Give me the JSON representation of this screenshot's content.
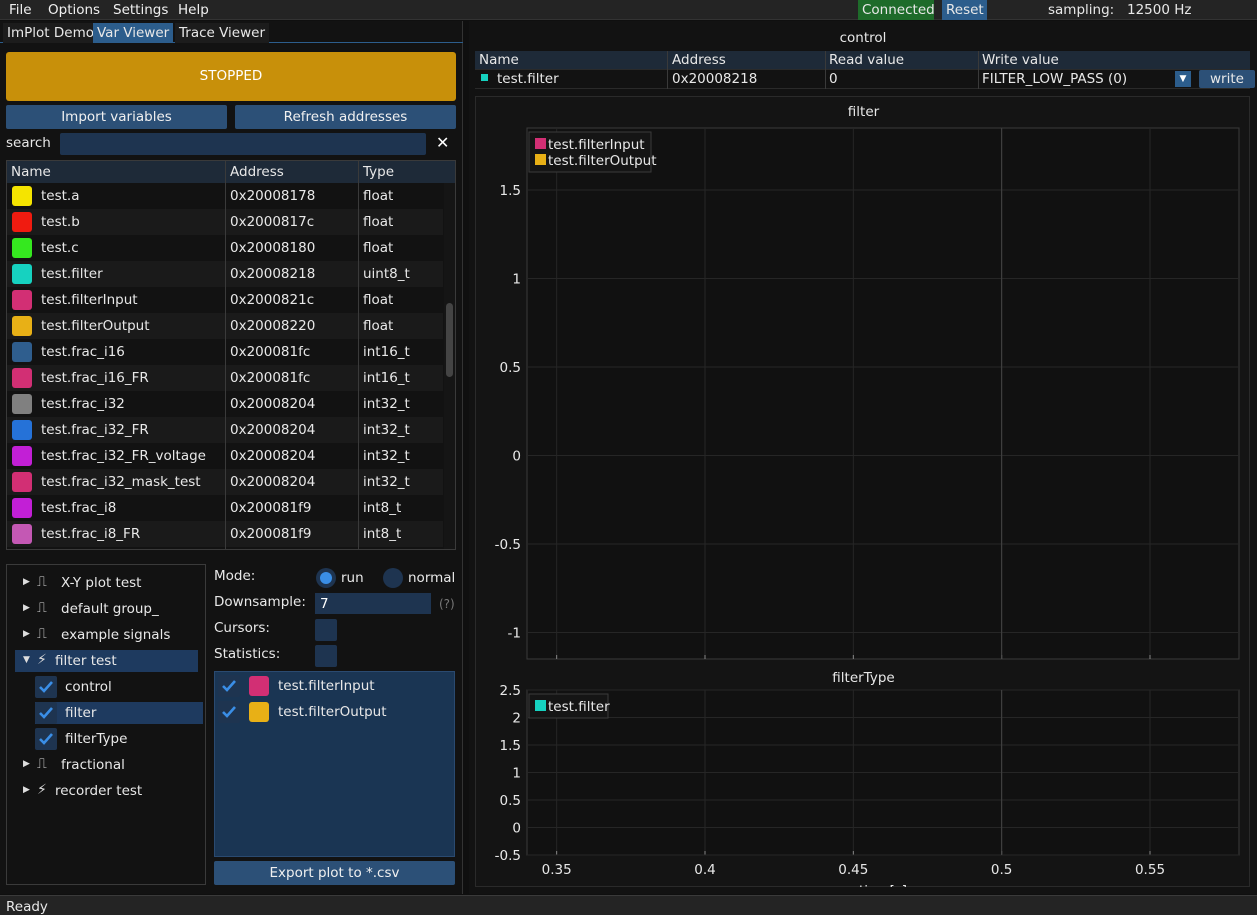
{
  "menu": {
    "file": "File",
    "options": "Options",
    "settings": "Settings",
    "help": "Help"
  },
  "connection": {
    "status": "Connected",
    "reset": "Reset",
    "sampling_label": "sampling:",
    "sampling_value": "12500 Hz"
  },
  "tabs": [
    "ImPlot Demo",
    "Var Viewer",
    "Trace Viewer"
  ],
  "run_state": "STOPPED",
  "buttons": {
    "import": "Import variables",
    "refresh": "Refresh addresses",
    "export": "Export plot to *.csv",
    "write": "write"
  },
  "search": {
    "label": "search",
    "value": "",
    "clear": "✕"
  },
  "var_table": {
    "headers": [
      "Name",
      "Address",
      "Type"
    ],
    "rows": [
      {
        "color": "#f5e400",
        "name": "test.a",
        "address": "0x20008178",
        "type": "float"
      },
      {
        "color": "#f01b10",
        "name": "test.b",
        "address": "0x2000817c",
        "type": "float"
      },
      {
        "color": "#35e81f",
        "name": "test.c",
        "address": "0x20008180",
        "type": "float"
      },
      {
        "color": "#16d2c0",
        "name": "test.filter",
        "address": "0x20008218",
        "type": "uint8_t"
      },
      {
        "color": "#d22f74",
        "name": "test.filterInput",
        "address": "0x2000821c",
        "type": "float"
      },
      {
        "color": "#e8b016",
        "name": "test.filterOutput",
        "address": "0x20008220",
        "type": "float"
      },
      {
        "color": "#2f5e8e",
        "name": "test.frac_i16",
        "address": "0x200081fc",
        "type": "int16_t"
      },
      {
        "color": "#d22f74",
        "name": "test.frac_i16_FR",
        "address": "0x200081fc",
        "type": "int16_t"
      },
      {
        "color": "#808080",
        "name": "test.frac_i32",
        "address": "0x20008204",
        "type": "int32_t"
      },
      {
        "color": "#2572d8",
        "name": "test.frac_i32_FR",
        "address": "0x20008204",
        "type": "int32_t"
      },
      {
        "color": "#c21fd6",
        "name": "test.frac_i32_FR_voltage",
        "address": "0x20008204",
        "type": "int32_t"
      },
      {
        "color": "#d22f74",
        "name": "test.frac_i32_mask_test",
        "address": "0x20008204",
        "type": "int32_t"
      },
      {
        "color": "#c21fd6",
        "name": "test.frac_i8",
        "address": "0x200081f9",
        "type": "int8_t"
      },
      {
        "color": "#c458b4",
        "name": "test.frac_i8_FR",
        "address": "0x200081f9",
        "type": "int8_t"
      }
    ]
  },
  "tree": [
    {
      "label": "X-Y plot test",
      "icon": "signal-icon"
    },
    {
      "label": "default group_",
      "icon": "signal-icon"
    },
    {
      "label": "example signals",
      "icon": "signal-icon"
    },
    {
      "label": "filter test",
      "icon": "bolt-icon",
      "children": [
        "control",
        "filter",
        "filterType"
      ]
    },
    {
      "label": "fractional",
      "icon": "signal-icon"
    },
    {
      "label": "recorder test",
      "icon": "bolt-icon"
    }
  ],
  "options": {
    "mode_label": "Mode:",
    "mode_run": "run",
    "mode_normal": "normal",
    "downsample_label": "Downsample:",
    "downsample_value": "7",
    "help": "(?)",
    "cursors_label": "Cursors:",
    "statistics_label": "Statistics:"
  },
  "plot_vars": [
    {
      "name": "test.filterInput",
      "color": "#d22f74"
    },
    {
      "name": "test.filterOutput",
      "color": "#e8b016"
    }
  ],
  "control": {
    "title": "control",
    "headers": [
      "Name",
      "Address",
      "Read value",
      "Write value"
    ],
    "row": {
      "color": "#16d2c0",
      "name": "test.filter",
      "address": "0x20008218",
      "read": "0",
      "write": "FILTER_LOW_PASS (0)"
    }
  },
  "chart_data": [
    {
      "type": "line",
      "title": "filter",
      "xlim": [
        0.34,
        0.58
      ],
      "ylim": [
        -1.15,
        1.85
      ],
      "yticks": [
        "1.5",
        "1",
        "0.5",
        "0",
        "-0.5",
        "-1"
      ],
      "series": [
        {
          "name": "test.filterInput",
          "color": "#d22f74",
          "values": []
        },
        {
          "name": "test.filterOutput",
          "color": "#e8b016",
          "values": []
        }
      ],
      "legend": "top-left",
      "grid": true
    },
    {
      "type": "line",
      "title": "filterType",
      "xlabel": "time[s]",
      "xlim": [
        0.34,
        0.58
      ],
      "ylim": [
        -0.5,
        2.5
      ],
      "xticks": [
        "0.35",
        "0.4",
        "0.45",
        "0.5",
        "0.55"
      ],
      "yticks": [
        "2.5",
        "2",
        "1.5",
        "1",
        "0.5",
        "0",
        "-0.5"
      ],
      "series": [
        {
          "name": "test.filter",
          "color": "#16d2c0",
          "values": []
        }
      ],
      "legend": "top-left",
      "grid": true
    }
  ],
  "status": "Ready"
}
